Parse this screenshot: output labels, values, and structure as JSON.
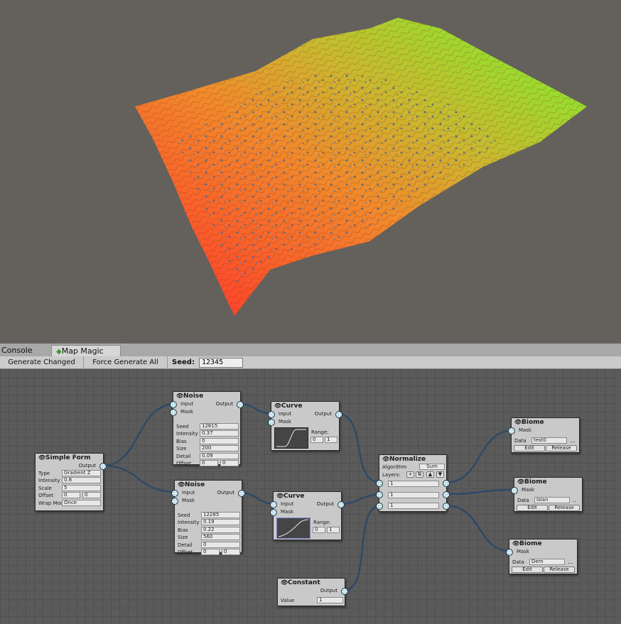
{
  "tabs": {
    "console": "Console",
    "map_magic": "Map Magic"
  },
  "toolbar": {
    "generate_changed": "Generate Changed",
    "force_generate_all": "Force Generate All",
    "seed_label": "Seed:",
    "seed_value": "12345"
  },
  "colors": {
    "terrain_low": "#ff3b2a",
    "terrain_mid": "#f39a2a",
    "terrain_high": "#7fee2c",
    "viewport_bg": "#64605c",
    "graph_bg": "#5b5b5b",
    "node_bg": "#c9c9c9",
    "port": "#8fc6de",
    "wire": "#2e4a66"
  },
  "nodes": {
    "simple_form": {
      "title": "Simple Form",
      "output": "Output",
      "type_label": "Type",
      "type_value": "Gradient Z",
      "intensity_label": "Intensity",
      "intensity_value": "0.8",
      "scale_label": "Scale",
      "scale_value": "5",
      "offset_label": "Offset",
      "offset_x": "0",
      "offset_y": "0",
      "wrap_label": "Wrap Mod",
      "wrap_value": "Once"
    },
    "noise1": {
      "title": "Noise",
      "input": "Input",
      "mask": "Mask",
      "output": "Output",
      "seed_label": "Seed",
      "seed_value": "12615",
      "intensity_label": "Intensity",
      "intensity_value": "0.37",
      "bias_label": "Bias",
      "bias_value": "0",
      "size_label": "Size",
      "size_value": "200",
      "detail_label": "Detail",
      "detail_value": "0.09",
      "offset_label": "Offset",
      "offset_x": "0",
      "offset_y": "0"
    },
    "noise2": {
      "title": "Noise",
      "input": "Input",
      "mask": "Mask",
      "output": "Output",
      "seed_label": "Seed",
      "seed_value": "12285",
      "intensity_label": "Intensity",
      "intensity_value": "0.19",
      "bias_label": "Bias",
      "bias_value": "0.22",
      "size_label": "Size",
      "size_value": "560",
      "detail_label": "Detail",
      "detail_value": "0",
      "offset_label": "Offset",
      "offset_x": "0",
      "offset_y": "0"
    },
    "curve1": {
      "title": "Curve",
      "input": "Input",
      "mask": "Mask",
      "output": "Output",
      "range_label": "Range:",
      "range_min": "0",
      "range_max": "1"
    },
    "curve2": {
      "title": "Curve",
      "input": "Input",
      "mask": "Mask",
      "output": "Output",
      "range_label": "Range:",
      "range_min": "0",
      "range_max": "1"
    },
    "normalize": {
      "title": "Normalize",
      "algorithm_label": "Algorithm",
      "algorithm_value": "Sum",
      "layers_label": "Layers:",
      "layer1": "1",
      "layer2": "1",
      "layer3": "1"
    },
    "constant": {
      "title": "Constant",
      "output": "Output",
      "value_label": "Value",
      "value": "1"
    },
    "biome1": {
      "title": "Biome",
      "mask": "Mask",
      "data_label": "Data",
      "data_value": "test0",
      "edit": "Edit",
      "release": "Release",
      "more": "..."
    },
    "biome2": {
      "title": "Biome",
      "mask": "Mask",
      "data_label": "Data",
      "data_value": "Islan",
      "edit": "Edit",
      "release": "Release",
      "more": ".."
    },
    "biome3": {
      "title": "Biome",
      "mask": "Mask",
      "data_label": "Data",
      "data_value": "Dem",
      "edit": "Edit",
      "release": "Release",
      "more": "..."
    }
  }
}
